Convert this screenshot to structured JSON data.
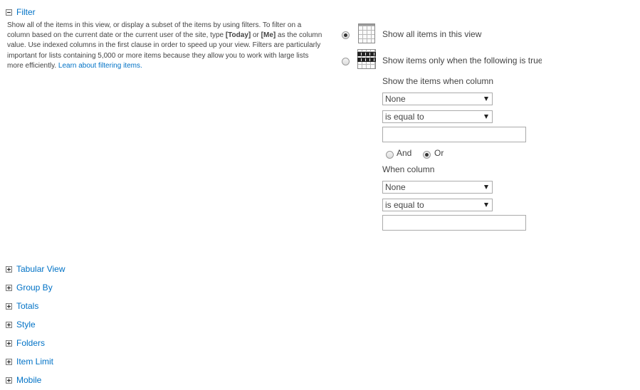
{
  "filter": {
    "section_label": "Filter",
    "description": {
      "part1": "Show all of the items in this view, or display a subset of the items by using filters. To filter on a column based on the current date or the current user of the site, type ",
      "today_token": "[Today]",
      "or_word": " or ",
      "me_token": "[Me]",
      "part2": " as the column value. Use indexed columns in the first clause in order to speed up your view. Filters are particularly important for lists containing 5,000 or more items because they allow you to work with large lists more efficiently. ",
      "learn_link": "Learn about filtering items."
    },
    "options": {
      "show_all": {
        "label": "Show all items in this view",
        "checked": true
      },
      "show_filtered": {
        "label": "Show items only when the following is true:",
        "checked": false
      }
    },
    "clause1": {
      "heading": "Show the items when column",
      "column_value": "None",
      "operator_value": "is equal to",
      "value": ""
    },
    "connector": {
      "and_label": "And",
      "or_label": "Or",
      "selected": "Or"
    },
    "clause2": {
      "heading": "When column",
      "column_value": "None",
      "operator_value": "is equal to",
      "value": ""
    }
  },
  "sections": [
    {
      "label": "Tabular View",
      "expanded": false
    },
    {
      "label": "Group By",
      "expanded": false
    },
    {
      "label": "Totals",
      "expanded": false
    },
    {
      "label": "Style",
      "expanded": false
    },
    {
      "label": "Folders",
      "expanded": false
    },
    {
      "label": "Item Limit",
      "expanded": false
    },
    {
      "label": "Mobile",
      "expanded": false
    }
  ],
  "colors": {
    "link": "#0072c6",
    "text": "#444444",
    "border": "#ababab"
  },
  "icons": {
    "show_all": "grid-icon",
    "show_filtered": "filter-grid-icon",
    "expand": "expand-plus-icon",
    "collapse": "collapse-minus-icon"
  }
}
